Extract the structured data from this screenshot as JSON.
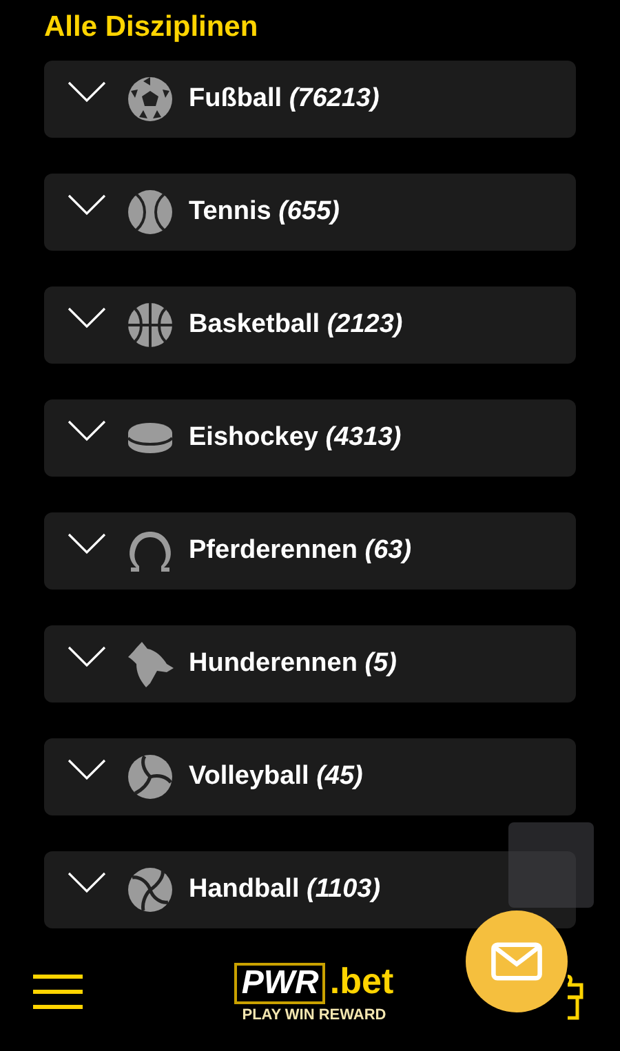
{
  "title": "Alle Disziplinen",
  "sports": [
    {
      "kind": "soccer",
      "label": "Fußball *(76213)*",
      "expanded": false
    },
    {
      "kind": "tennis",
      "label": "Tennis *(655)*",
      "expanded": false
    },
    {
      "kind": "basketball",
      "label": "Basketball *(2123)*",
      "expanded": false
    },
    {
      "kind": "hockey",
      "label": "Eishockey *(4313)*",
      "expanded": false
    },
    {
      "kind": "horseshoe",
      "label": "Pferderennen *(63)*",
      "expanded": false
    },
    {
      "kind": "dog",
      "label": "Hunderennen *(5)*",
      "expanded": false
    },
    {
      "kind": "volleyball",
      "label": "Volleyball *(45)*",
      "expanded": false
    },
    {
      "kind": "handball",
      "label": "Handball *(1103)*",
      "expanded": false
    }
  ],
  "logo": {
    "brand": "PWR",
    "suffix": ".bet",
    "tagline": "PLAY WIN REWARD"
  }
}
